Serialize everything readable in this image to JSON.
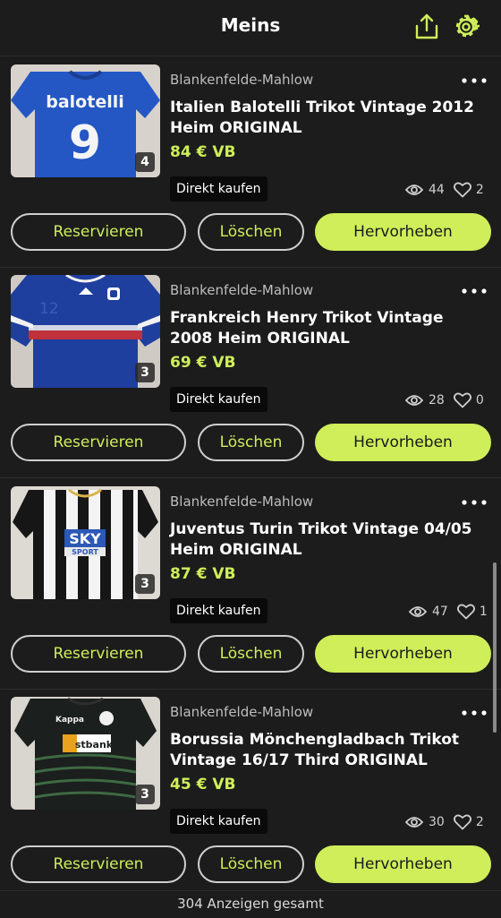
{
  "header": {
    "title": "Meins",
    "share_icon": "share-upload-icon",
    "settings_icon": "gear-icon"
  },
  "colors": {
    "background": "#1c1c1c",
    "accent": "#cfee5a",
    "text": "#ffffff",
    "muted": "#bdbdbd"
  },
  "listings": [
    {
      "location": "Blankenfelde-Mahlow",
      "title": "Italien Balotelli Trikot Vintage 2012 Heim ORIGINAL",
      "price": "84 € VB",
      "image_count": "4",
      "badge": "Direkt kaufen",
      "views": "44",
      "likes": "2",
      "reserve_label": "Reservieren",
      "delete_label": "Löschen",
      "highlight_label": "Hervorheben",
      "jersey_text": "balotelli",
      "jersey_number": "9"
    },
    {
      "location": "Blankenfelde-Mahlow",
      "title": "Frankreich Henry Trikot Vintage 2008 Heim ORIGINAL",
      "price": "69 € VB",
      "image_count": "3",
      "badge": "Direkt kaufen",
      "views": "28",
      "likes": "0",
      "reserve_label": "Reservieren",
      "delete_label": "Löschen",
      "highlight_label": "Hervorheben",
      "jersey_number": "12"
    },
    {
      "location": "Blankenfelde-Mahlow",
      "title": "Juventus Turin Trikot Vintage 04/05 Heim ORIGINAL",
      "price": "87 € VB",
      "image_count": "3",
      "badge": "Direkt kaufen",
      "views": "47",
      "likes": "1",
      "reserve_label": "Reservieren",
      "delete_label": "Löschen",
      "highlight_label": "Hervorheben",
      "sponsor": "SKY",
      "sponsor_sub": "SPORT"
    },
    {
      "location": "Blankenfelde-Mahlow",
      "title": "Borussia Mönchengladbach Trikot Vintage 16/17 Third ORIGINAL",
      "price": "45 € VB",
      "image_count": "3",
      "badge": "Direkt kaufen",
      "views": "30",
      "likes": "2",
      "reserve_label": "Reservieren",
      "delete_label": "Löschen",
      "highlight_label": "Hervorheben",
      "brand": "Kappa",
      "sponsor": "stbank"
    }
  ],
  "footer": {
    "total_text": "304 Anzeigen gesamt"
  }
}
